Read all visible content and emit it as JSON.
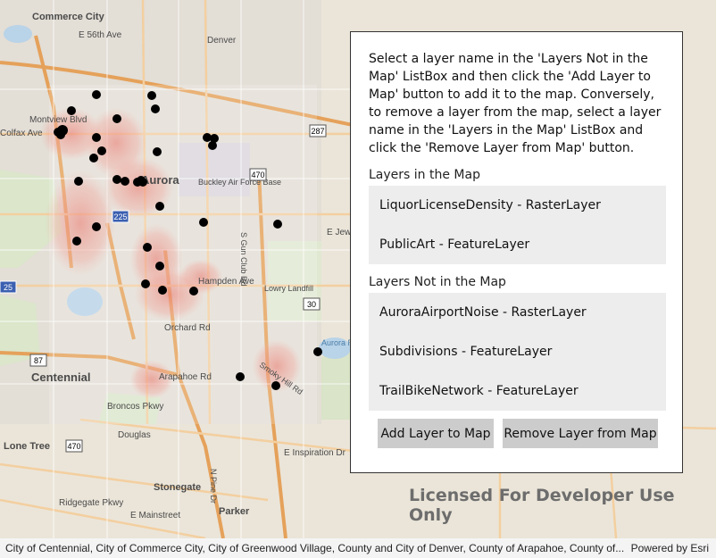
{
  "map": {
    "labels": [
      "Commerce City",
      "E 56th Ave",
      "Denver",
      "Montview Blvd",
      "Colfax Ave",
      "Aurora",
      "Buckley Air Force Base",
      "E Jewell",
      "Hampden Ave",
      "Lowry Landfill",
      "Orchard Rd",
      "Arapahoe Rd",
      "Broncos Pkwy",
      "Centennial",
      "Lone Tree",
      "Douglas",
      "E Inspiration Dr",
      "Stonegate",
      "Parker",
      "Ridgegate Pkwy",
      "E Mainstreet",
      "Aurora Reservoir",
      "Smoky Hill Rd",
      "S Gun Club Rd",
      "N Pine Dr"
    ],
    "shields": [
      "287",
      "470",
      "225",
      "25",
      "87",
      "30",
      "470",
      "470"
    ]
  },
  "license_text": "Licensed For Developer Use Only",
  "attribution": {
    "text": "City of Centennial, City of Commerce City, City of Greenwood Village, County and City of Denver, County of Arapahoe, County of...",
    "powered_by": "Powered by Esri"
  },
  "panel": {
    "instructions": "Select a layer name in the 'Layers Not in the Map' ListBox and then click the 'Add Layer to Map' button to add it to the map. Conversely, to remove a layer from the map, select a layer name in the 'Layers in the Map' ListBox and click the 'Remove Layer from Map' button.",
    "layers_in_map_label": "Layers in the Map",
    "layers_in_map": [
      "LiquorLicenseDensity - RasterLayer",
      "PublicArt - FeatureLayer"
    ],
    "layers_not_in_map_label": "Layers Not in the Map",
    "layers_not_in_map": [
      "AuroraAirportNoise - RasterLayer",
      "Subdivisions - FeatureLayer",
      "TrailBikeNetwork - FeatureLayer"
    ],
    "add_button": "Add Layer to Map",
    "remove_button": "Remove Layer from Map"
  }
}
